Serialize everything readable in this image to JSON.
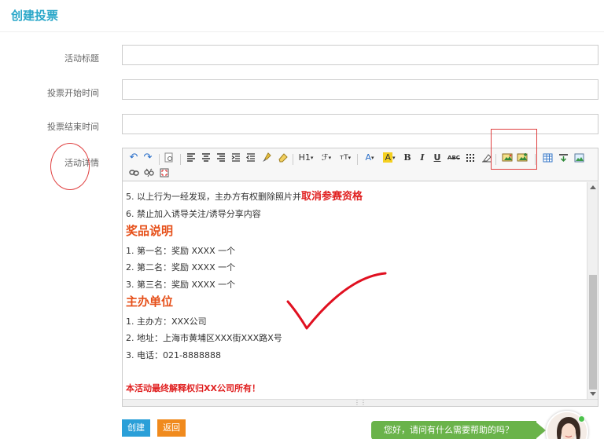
{
  "page": {
    "title": "创建投票"
  },
  "form": {
    "title_label": "活动标题",
    "start_label": "投票开始时间",
    "end_label": "投票结束时间",
    "details_label": "活动详情"
  },
  "toolbar": {
    "heading_label": "H1",
    "bold_label": "B",
    "italic_label": "I",
    "underline_label": "U",
    "strike_label": "ABC",
    "font_color_label": "A",
    "bg_color_label": "A"
  },
  "editor": {
    "line1_text": "5. 以上行为一经发现，主办方有权删除照片并",
    "line1_emph": "取消参赛资格",
    "line2": "6. 禁止加入诱导关注/诱导分享内容",
    "heading_prizes": "奖品说明",
    "prize1": "1. 第一名：奖励 XXXX 一个",
    "prize2": "2. 第二名：奖励 XXXX 一个",
    "prize3": "3. 第三名：奖励 XXXX 一个",
    "heading_organizer": "主办单位",
    "org1": "1. 主办方：XXX公司",
    "org2": "2. 地址：上海市黄埔区XXX街XXX路X号",
    "org3": "3. 电话：021-8888888",
    "footer_note": "本活动最终解释权归XX公司所有！"
  },
  "buttons": {
    "create": "创建",
    "back": "返回"
  },
  "help": {
    "text": "您好，请问有什么需要帮助的吗？"
  },
  "colors": {
    "accent": "#2aa7c9",
    "create_button": "#2a9fd8",
    "back_button": "#f08a1d",
    "heading_orange": "#e6501a",
    "emphasis_red": "#e02020",
    "help_green": "#6ab34a",
    "annotation_red": "#e04040"
  },
  "icons": [
    "undo-icon",
    "redo-icon",
    "preview-icon",
    "align-left-icon",
    "align-center-icon",
    "align-right-icon",
    "indent-icon",
    "outdent-icon",
    "brush-icon",
    "eraser-icon",
    "font-family-icon",
    "font-size-icon",
    "table-grid-icon",
    "clear-format-icon",
    "insert-image-icon",
    "insert-multi-image-icon",
    "table-icon",
    "insert-row-icon",
    "picture-icon",
    "link-icon",
    "unlink-icon",
    "fullscreen-icon"
  ]
}
